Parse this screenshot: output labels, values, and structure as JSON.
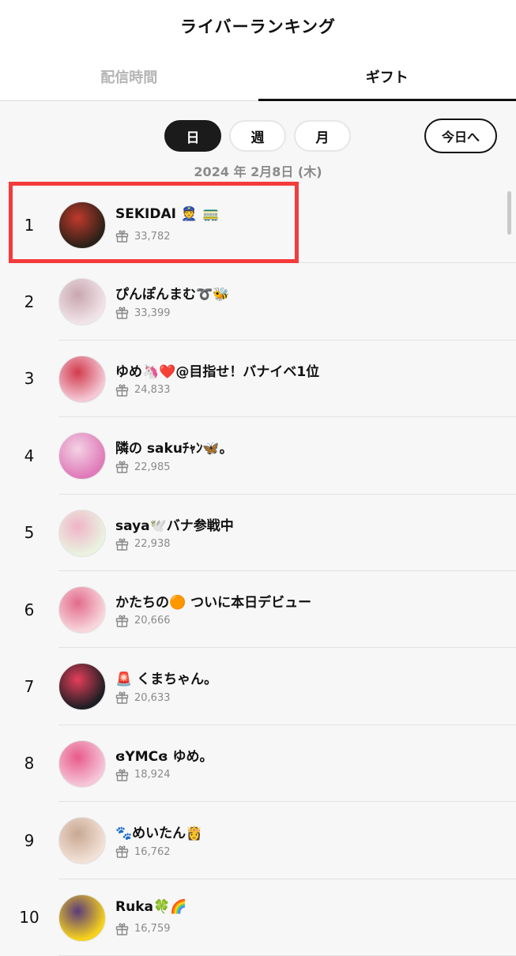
{
  "header": {
    "title": "ライバーランキング"
  },
  "tabs": [
    {
      "label": "配信時間",
      "active": false
    },
    {
      "label": "ギフト",
      "active": true
    }
  ],
  "period": {
    "options": [
      "日",
      "週",
      "月"
    ],
    "selected": "日",
    "today_label": "今日へ",
    "date": "2024 年 2月8日 (木)"
  },
  "ranking": [
    {
      "rank": "1",
      "name": "SEKIDAI 👮 🚃",
      "gifts": "33,782",
      "avatar_colors": [
        "#2b2118",
        "#c0392b"
      ]
    },
    {
      "rank": "2",
      "name": "ぴんぽんまむ➰🐝",
      "gifts": "33,399",
      "avatar_colors": [
        "#f0e4e8",
        "#c9a6b0"
      ]
    },
    {
      "rank": "3",
      "name": "ゆめ🦄❤️@目指せ！バナイベ1位",
      "gifts": "24,833",
      "avatar_colors": [
        "#f4c9d6",
        "#d23b4e"
      ]
    },
    {
      "rank": "4",
      "name": "隣の sakuﾁｬﾝ🦋。",
      "gifts": "22,985",
      "avatar_colors": [
        "#e07ab9",
        "#f2d3e4"
      ]
    },
    {
      "rank": "5",
      "name": "saya🕊️バナ参戦中",
      "gifts": "22,938",
      "avatar_colors": [
        "#e9f3e0",
        "#f0b4c8"
      ]
    },
    {
      "rank": "6",
      "name": "かたちの🟠 ついに本日デビュー",
      "gifts": "20,666",
      "avatar_colors": [
        "#f7d7dc",
        "#e36b8c"
      ]
    },
    {
      "rank": "7",
      "name": "🚨 くまちゃん。",
      "gifts": "20,633",
      "avatar_colors": [
        "#1e1e24",
        "#e63e5a"
      ]
    },
    {
      "rank": "8",
      "name": "ɞYMCɞ ゆめ。",
      "gifts": "18,924",
      "avatar_colors": [
        "#f5c6d8",
        "#e85a8a"
      ]
    },
    {
      "rank": "9",
      "name": "🐾めいたん👸",
      "gifts": "16,762",
      "avatar_colors": [
        "#f2e1d6",
        "#c8a893"
      ]
    },
    {
      "rank": "10",
      "name": "Ruka🍀🌈",
      "gifts": "16,759",
      "avatar_colors": [
        "#f7d31c",
        "#5b3b7a"
      ]
    }
  ]
}
